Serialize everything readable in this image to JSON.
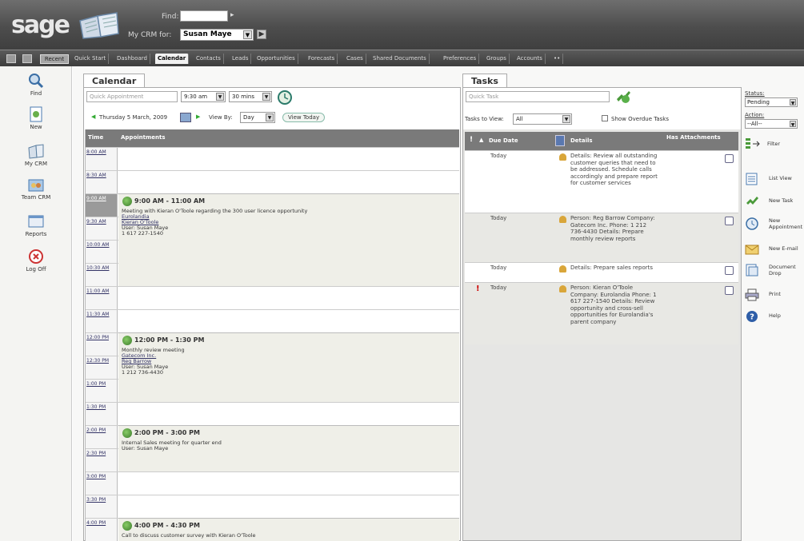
{
  "header": {
    "logo": "sage",
    "find_label": "Find:",
    "mycrm_label": "My CRM for:",
    "mycrm_value": "Susan Maye"
  },
  "tabs": [
    "Recent",
    "Quick Start",
    "Dashboard",
    "Calendar",
    "Contacts",
    "Leads",
    "Opportunities",
    "Forecasts",
    "Cases",
    "Shared Documents",
    "Preferences",
    "Groups",
    "Accounts",
    "••"
  ],
  "active_tab": "Calendar",
  "leftnav": [
    {
      "label": "Find",
      "icon": "magnifier-icon"
    },
    {
      "label": "New",
      "icon": "new-document-icon"
    },
    {
      "label": "My CRM",
      "icon": "my-crm-book-icon"
    },
    {
      "label": "Team CRM",
      "icon": "team-crm-icon"
    },
    {
      "label": "Reports",
      "icon": "reports-icon"
    },
    {
      "label": "Log Off",
      "icon": "log-off-icon"
    }
  ],
  "calendar": {
    "tab_label": "Calendar",
    "quick_appointment_placeholder": "Quick Appointment",
    "time_select": "9:30 am",
    "duration_select": "30 mins",
    "date_label": "Thursday 5 March, 2009",
    "view_by_label": "View By:",
    "view_by_value": "Day",
    "view_today": "View Today",
    "col_time": "Time",
    "col_appointments": "Appointments",
    "slots": [
      "8:00 AM",
      "8:30 AM",
      "9:00 AM",
      "9:30 AM",
      "10:00 AM",
      "10:30 AM",
      "11:00 AM",
      "11:30 AM",
      "12:00 PM",
      "12:30 PM",
      "1:00 PM",
      "1:30 PM",
      "2:00 PM",
      "2:30 PM",
      "3:00 PM",
      "3:30 PM",
      "4:00 PM"
    ],
    "appointments": [
      {
        "title": "9:00 AM - 11:00 AM",
        "lines": [
          "Meeting with Kieran O'Toole regarding the 300 user licence opportunity",
          "Eurolandia",
          "Kieran O'Toole",
          "User: Susan Maye",
          "1 617 227-1540"
        ]
      },
      {
        "title": "12:00 PM - 1:30 PM",
        "lines": [
          "Monthly review meeting",
          "Gatecom Inc.",
          "Reg Barrow",
          "User: Susan Maye",
          "1 212 736-4430"
        ]
      },
      {
        "title": "2:00 PM - 3:00 PM",
        "lines": [
          "Internal Sales meeting for quarter end",
          "User: Susan Maye"
        ]
      },
      {
        "title": "4:00 PM - 4:30 PM",
        "lines": [
          "Call to discuss customer survey with Kieran O'Toole"
        ]
      }
    ]
  },
  "tasks": {
    "tab_label": "Tasks",
    "quick_task_placeholder": "Quick Task",
    "tasks_to_view_label": "Tasks to View:",
    "tasks_to_view_value": "All",
    "show_overdue_label": "Show Overdue Tasks",
    "col_due_date": "Due Date",
    "col_details": "Details",
    "col_has_attachments": "Has Attachments",
    "rows": [
      {
        "due": "Today",
        "priority": "",
        "details": "Details: Review all outstanding customer queries that need to be addressed. Schedule calls accordingly and prepare report for customer services"
      },
      {
        "due": "Today",
        "priority": "",
        "details": "Person: Reg Barrow Company: Gatecom Inc. Phone: 1 212 736-4430 Details: Prepare monthly review reports"
      },
      {
        "due": "Today",
        "priority": "",
        "details": "Details: Prepare sales reports"
      },
      {
        "due": "Today",
        "priority": "!",
        "details": "Person: Kieran O'Toole Company: Eurolandia Phone: 1 617 227-1540 Details: Review opportunity and cross-sell opportunities for Eurolandia's parent company"
      }
    ]
  },
  "right_panel": {
    "status_label": "Status:",
    "status_value": "Pending",
    "action_label": "Action:",
    "action_value": "--All--",
    "filter_label": "Filter",
    "actions": [
      {
        "label": "List View",
        "icon": "list-view-icon"
      },
      {
        "label": "New Task",
        "icon": "new-task-icon"
      },
      {
        "label": "New Appointment",
        "icon": "new-appointment-icon"
      },
      {
        "label": "New E-mail",
        "icon": "new-email-icon"
      },
      {
        "label": "Document Drop",
        "icon": "document-drop-icon"
      },
      {
        "label": "Print",
        "icon": "print-icon"
      },
      {
        "label": "Help",
        "icon": "help-icon"
      }
    ]
  }
}
